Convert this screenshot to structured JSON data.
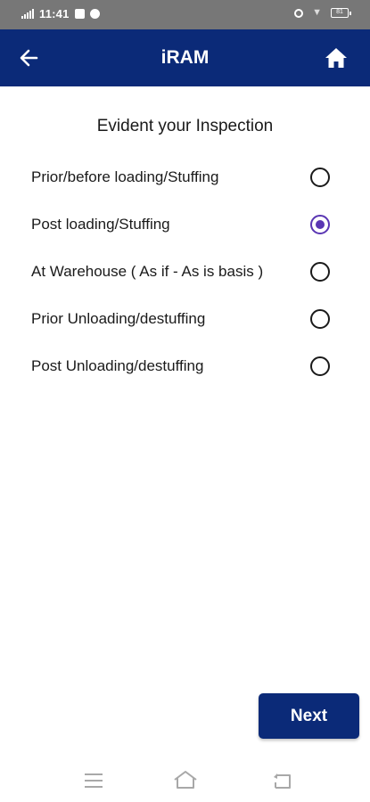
{
  "status_bar": {
    "time": "11:41",
    "battery": "81"
  },
  "app_bar": {
    "title": "iRAM",
    "back_icon": "arrow-left-icon",
    "home_icon": "home-icon"
  },
  "content": {
    "heading": "Evident your Inspection",
    "options": [
      {
        "label": "Prior/before loading/Stuffing",
        "selected": false
      },
      {
        "label": "Post loading/Stuffing",
        "selected": true
      },
      {
        "label": "At Warehouse ( As if - As is basis )",
        "selected": false
      },
      {
        "label": "Prior Unloading/destuffing",
        "selected": false
      },
      {
        "label": "Post Unloading/destuffing",
        "selected": false
      }
    ],
    "next_label": "Next"
  },
  "nav_bar": {
    "icons": [
      "menu-icon",
      "home-icon",
      "back-icon"
    ]
  },
  "colors": {
    "primary": "#0b2a78",
    "radio_selected": "#5a36b3",
    "status_bar": "#777777"
  }
}
